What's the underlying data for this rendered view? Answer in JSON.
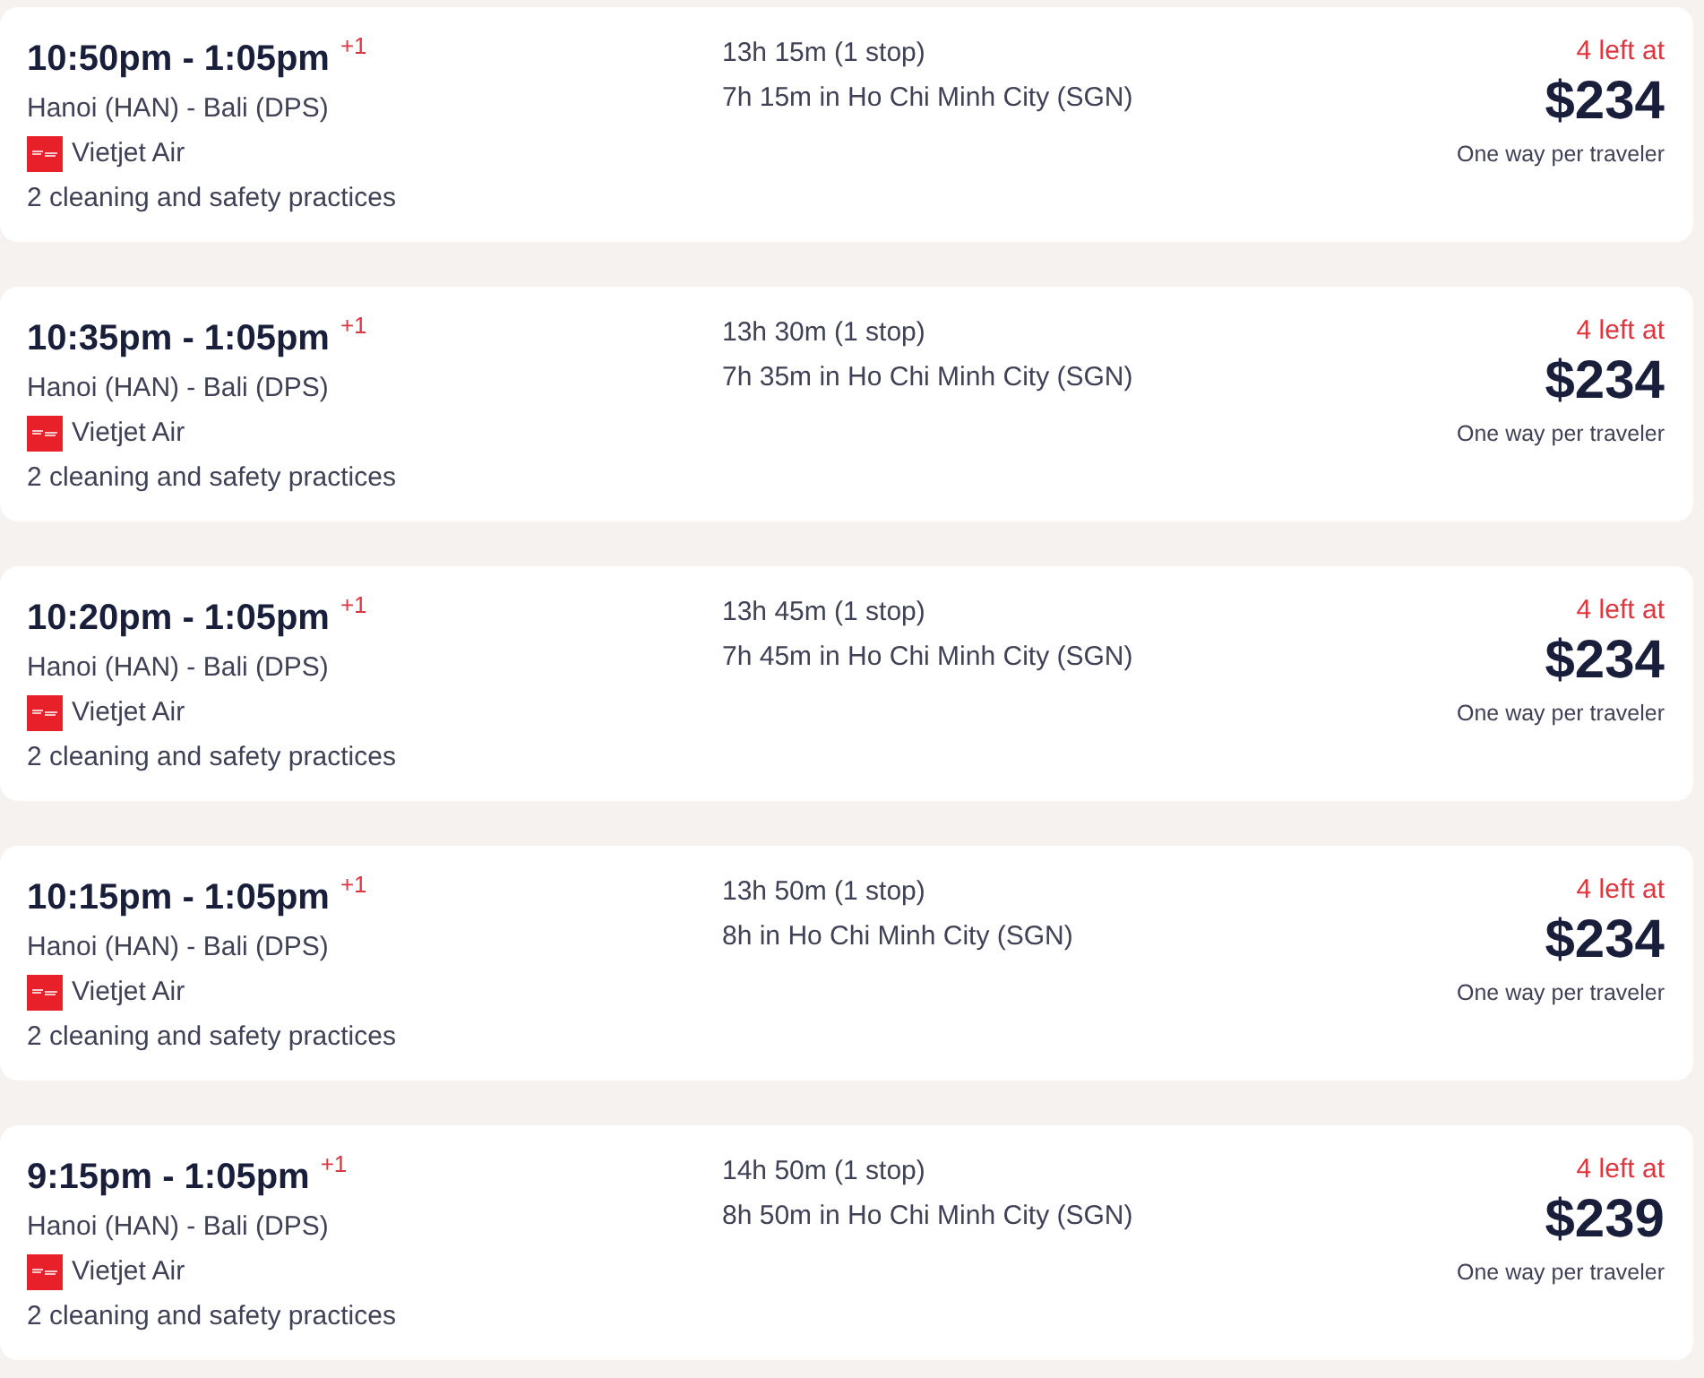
{
  "flights": [
    {
      "times": "10:50pm - 1:05pm",
      "day_offset": "+1",
      "route": "Hanoi (HAN) - Bali (DPS)",
      "airline": "Vietjet Air",
      "cleaning": "2 cleaning and safety practices",
      "duration": "13h 15m (1 stop)",
      "layover": "7h 15m in Ho Chi Minh City (SGN)",
      "seats_left": "4 left at",
      "price": "$234",
      "price_note": "One way per traveler"
    },
    {
      "times": "10:35pm - 1:05pm",
      "day_offset": "+1",
      "route": "Hanoi (HAN) - Bali (DPS)",
      "airline": "Vietjet Air",
      "cleaning": "2 cleaning and safety practices",
      "duration": "13h 30m (1 stop)",
      "layover": "7h 35m in Ho Chi Minh City (SGN)",
      "seats_left": "4 left at",
      "price": "$234",
      "price_note": "One way per traveler"
    },
    {
      "times": "10:20pm - 1:05pm",
      "day_offset": "+1",
      "route": "Hanoi (HAN) - Bali (DPS)",
      "airline": "Vietjet Air",
      "cleaning": "2 cleaning and safety practices",
      "duration": "13h 45m (1 stop)",
      "layover": "7h 45m in Ho Chi Minh City (SGN)",
      "seats_left": "4 left at",
      "price": "$234",
      "price_note": "One way per traveler"
    },
    {
      "times": "10:15pm - 1:05pm",
      "day_offset": "+1",
      "route": "Hanoi (HAN) - Bali (DPS)",
      "airline": "Vietjet Air",
      "cleaning": "2 cleaning and safety practices",
      "duration": "13h 50m (1 stop)",
      "layover": "8h in Ho Chi Minh City (SGN)",
      "seats_left": "4 left at",
      "price": "$234",
      "price_note": "One way per traveler"
    },
    {
      "times": "9:15pm - 1:05pm",
      "day_offset": "+1",
      "route": "Hanoi (HAN) - Bali (DPS)",
      "airline": "Vietjet Air",
      "cleaning": "2 cleaning and safety practices",
      "duration": "14h 50m (1 stop)",
      "layover": "8h 50m in Ho Chi Minh City (SGN)",
      "seats_left": "4 left at",
      "price": "$239",
      "price_note": "One way per traveler"
    }
  ]
}
